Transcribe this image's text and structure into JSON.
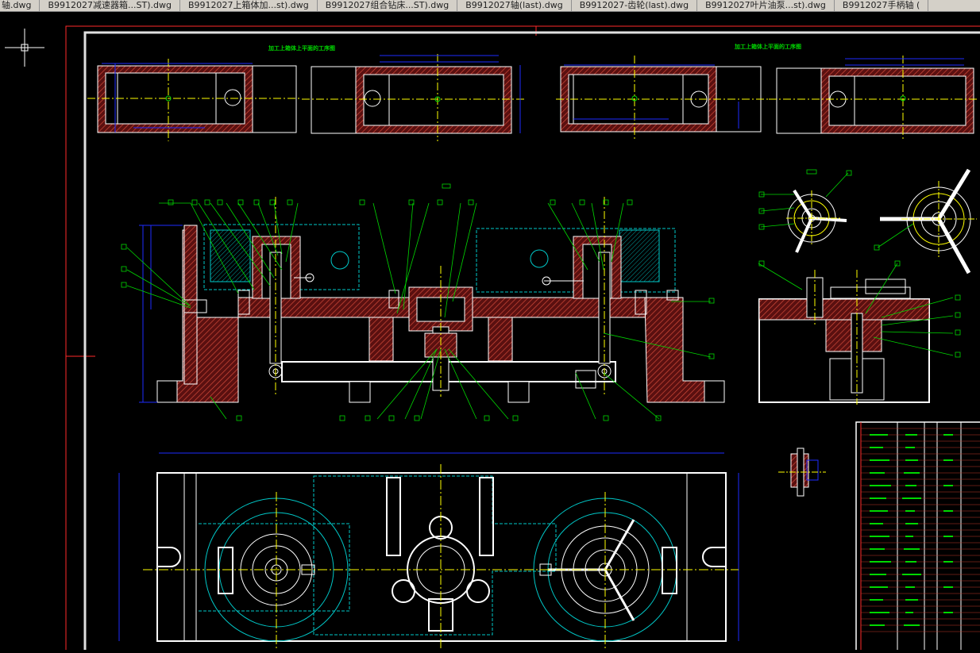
{
  "tabs": [
    {
      "label": "轴.dwg"
    },
    {
      "label": "B9912027减速器箱...ST).dwg"
    },
    {
      "label": "B9912027上箱体加...st).dwg"
    },
    {
      "label": "B9912027组合钻床...ST).dwg"
    },
    {
      "label": "B9912027轴(last).dwg"
    },
    {
      "label": "B9912027-齿轮(last).dwg"
    },
    {
      "label": "B9912027叶片油泵...st).dwg"
    },
    {
      "label": "B9912027手柄轴 ("
    }
  ],
  "drawing": {
    "view_title_left": "加工上箱体上平面的工序图",
    "view_title_right": "加工上箱体上平面的工序图",
    "balloon": "□",
    "colors": {
      "background": "#000000",
      "outline": "#ffffff",
      "hatch": "#c0392b",
      "centerline": "#ffff00",
      "dimension": "#1e2bff",
      "leader": "#00d800",
      "hidden": "#00c8c8",
      "border": "#ff2a2a"
    },
    "icons": [
      "crosshair-cursor-icon"
    ]
  }
}
